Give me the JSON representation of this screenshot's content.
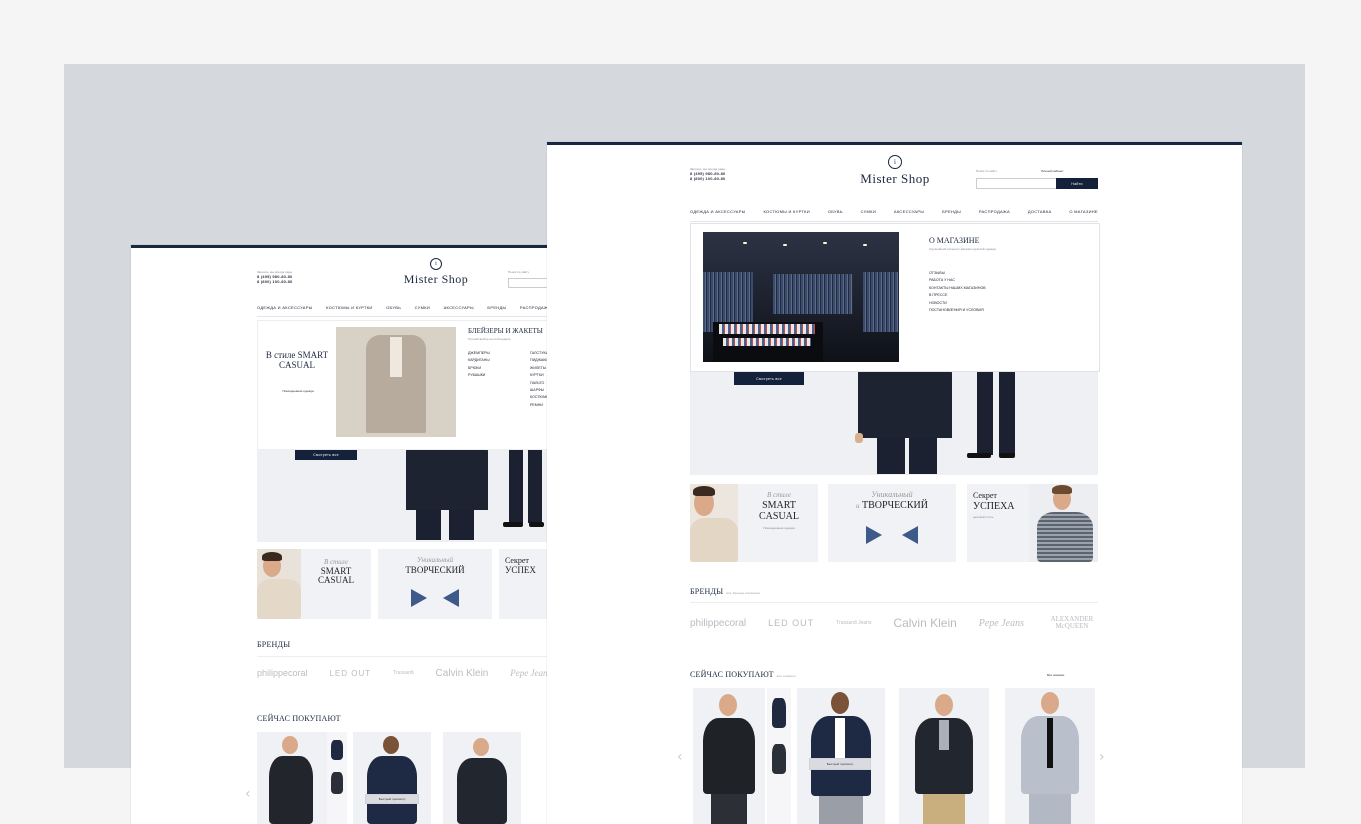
{
  "left": {
    "header": {
      "contact_line": "Звоните, мы всегда рады",
      "phone1": "8 (495) 980-80-80",
      "phone2": "8 (800) 100-80-80",
      "logo_text": "Mister Shop",
      "search_label": "Поиск по сайту"
    },
    "nav": [
      "Одежда и аксессуары",
      "Костюмы и куртки",
      "Обувь",
      "Сумки",
      "Аксессуары",
      "Бренды",
      "Распродажа"
    ],
    "hero": {
      "title": "В стиле SMART CASUAL",
      "sub": "Повседневная одежда",
      "cta": "Смотреть все",
      "menu_title": "Блейзеры и жакеты",
      "menu_sub": "Лучший выбор на этой неделе",
      "col1": [
        "Джемперы",
        "Кардиганы",
        "Брюки",
        "Рубашки"
      ],
      "col2": [
        "Галстуки",
        "Пиджаки",
        "Жилеты",
        "Куртки",
        "Пальто",
        "Шарфы",
        "Костюмы",
        "Ремни"
      ]
    },
    "promos": {
      "p1_ital": "В стиле",
      "p1_big": "SMART CASUAL",
      "p2_ital": "Уникальный",
      "p2_big": "ТВОРЧЕСКИЙ",
      "p3_small": "Секрет",
      "p3_big": "УСПЕХ"
    },
    "brands_title": "Бренды",
    "brands": [
      "philippecoral",
      "LED OUT",
      "Trussardi",
      "Calvin Klein",
      "Pepe Jeans"
    ],
    "buying_title": "Сейчас покупают",
    "chip": "Быстрый просмотр"
  },
  "right": {
    "header": {
      "contact_line": "Звоните, мы всегда рады",
      "phone1": "8 (495) 980-80-80",
      "phone2": "8 (800) 100-80-80",
      "logo_text": "Mister Shop",
      "search_label": "Поиск по сайту",
      "account": "Личный кабинет",
      "search_button": "Найти"
    },
    "nav": [
      "Одежда и аксессуары",
      "Костюмы и куртки",
      "Обувь",
      "Сумки",
      "Аксессуары",
      "Бренды",
      "Распродажа",
      "Доставка",
      "О магазине"
    ],
    "dropdown": {
      "title": "О магазине",
      "sub": "Крупнейший интернет-магазин мужской одежды",
      "items": [
        "Отзывы",
        "Работа у нас",
        "Контакты наших магазинов",
        "В прессе",
        "Новости",
        "Постановления и условия"
      ]
    },
    "cta": "Смотреть все",
    "promos": {
      "p1_ital": "В стиле",
      "p1_big1": "SMART",
      "p1_big2": "CASUAL",
      "p1_small": "Повседневная одежда",
      "p2_ital1": "Уникальный",
      "p2_ital2": "и",
      "p2_big": "ТВОРЧЕСКИЙ",
      "p3_small": "Секрет",
      "p3_big": "УСПЕХА",
      "p3_sub": "деловой стиль"
    },
    "brands_title": "Бренды",
    "brands_sub": "все бренды магазина",
    "brands": [
      "philippecoral",
      "LED OUT",
      "Trussardi Jeans",
      "Calvin Klein",
      "Pepe Jeans",
      "ALEXANDER McQUEEN"
    ],
    "buying_title": "Сейчас покупают",
    "buying_sub": "все новинки",
    "buying_link": "Все новинки",
    "chip": "Быстрый просмотр"
  },
  "colors": {
    "navy": "#13213a",
    "backdrop": "#d5d8dd",
    "page_bg": "#f5f5f5"
  }
}
